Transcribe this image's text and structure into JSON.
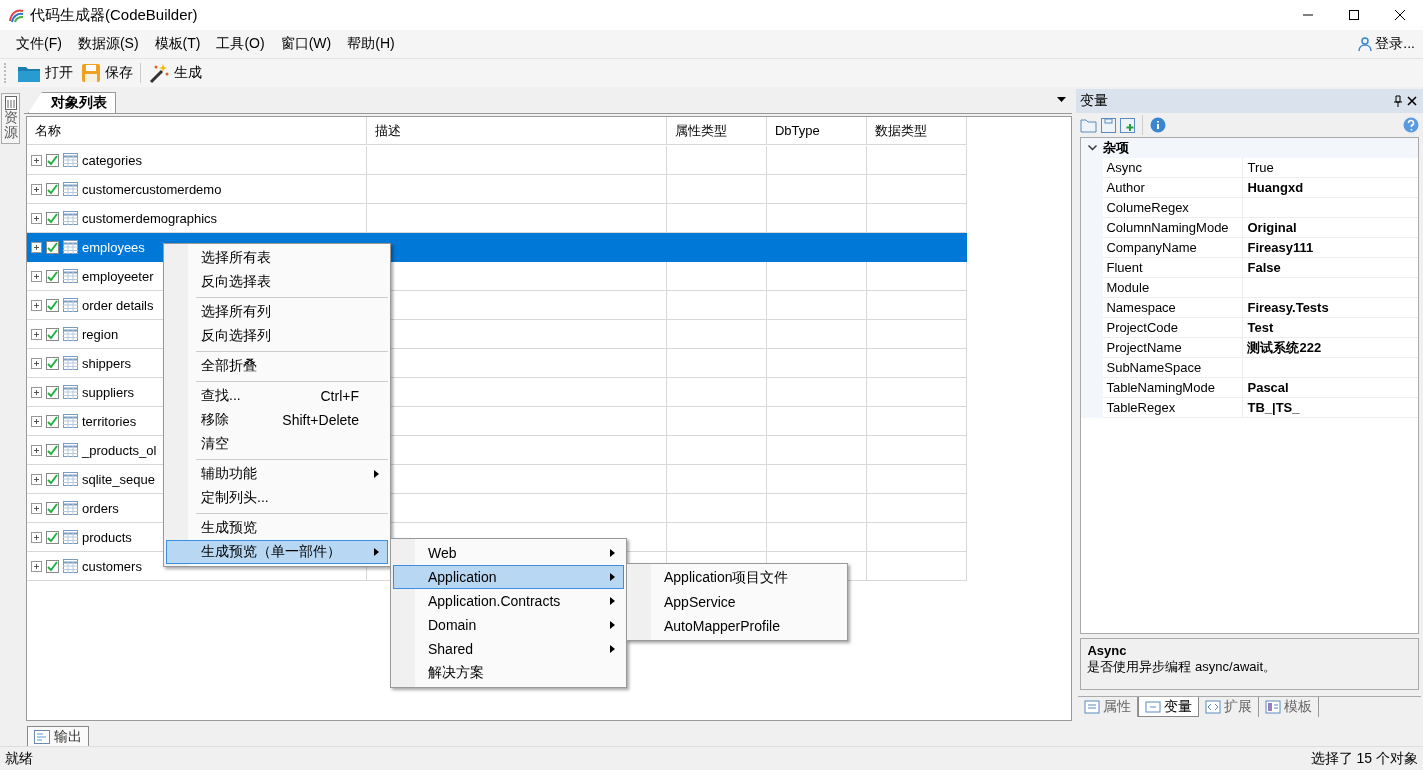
{
  "window": {
    "title": "代码生成器(CodeBuilder)"
  },
  "menu_bar": {
    "items": [
      "文件(F)",
      "数据源(S)",
      "模板(T)",
      "工具(O)",
      "窗口(W)",
      "帮助(H)"
    ],
    "login": "登录..."
  },
  "toolbar": [
    {
      "kind": "open",
      "label": "打开"
    },
    {
      "kind": "save",
      "label": "保存"
    },
    {
      "kind": "separator"
    },
    {
      "kind": "generate",
      "label": "生成"
    }
  ],
  "side_tabs": [
    {
      "label": "资源"
    }
  ],
  "document": {
    "tabs": [
      {
        "label": "对象列表",
        "selected": true
      }
    ],
    "table": {
      "columns": [
        "名称",
        "描述",
        "属性类型",
        "DbType",
        "数据类型"
      ],
      "rows": [
        {
          "name": "categories",
          "checked": true,
          "selected": false
        },
        {
          "name": "customercustomerdemo",
          "checked": true,
          "selected": false
        },
        {
          "name": "customerdemographics",
          "checked": true,
          "selected": false
        },
        {
          "name": "employees",
          "checked": true,
          "selected": true
        },
        {
          "name": "employeeter",
          "checked": true,
          "selected": false
        },
        {
          "name": "order details",
          "checked": true,
          "selected": false
        },
        {
          "name": "region",
          "checked": true,
          "selected": false
        },
        {
          "name": "shippers",
          "checked": true,
          "selected": false
        },
        {
          "name": "suppliers",
          "checked": true,
          "selected": false
        },
        {
          "name": "territories",
          "checked": true,
          "selected": false
        },
        {
          "name": "_products_ol",
          "checked": true,
          "selected": false
        },
        {
          "name": "sqlite_seque",
          "checked": true,
          "selected": false
        },
        {
          "name": "orders",
          "checked": true,
          "selected": false
        },
        {
          "name": "products",
          "checked": true,
          "selected": false
        },
        {
          "name": "customers",
          "checked": true,
          "selected": false
        }
      ]
    }
  },
  "context_menu": {
    "items": [
      {
        "kind": "item",
        "label": "选择所有表",
        "selected": false
      },
      {
        "kind": "item",
        "label": "反向选择表",
        "selected": false
      },
      {
        "kind": "separator"
      },
      {
        "kind": "item",
        "label": "选择所有列",
        "selected": false
      },
      {
        "kind": "item",
        "label": "反向选择列",
        "selected": false
      },
      {
        "kind": "separator"
      },
      {
        "kind": "item",
        "label": "全部折叠",
        "selected": false
      },
      {
        "kind": "separator"
      },
      {
        "kind": "item",
        "label": "查找...",
        "shortcut": "Ctrl+F",
        "selected": false
      },
      {
        "kind": "item",
        "label": "移除",
        "shortcut": "Shift+Delete",
        "selected": false
      },
      {
        "kind": "item",
        "label": "清空",
        "selected": false
      },
      {
        "kind": "separator"
      },
      {
        "kind": "item",
        "label": "辅助功能",
        "submenu": true,
        "selected": false
      },
      {
        "kind": "item",
        "label": "定制列头...",
        "selected": false
      },
      {
        "kind": "separator"
      },
      {
        "kind": "item",
        "label": "生成预览",
        "selected": false
      },
      {
        "kind": "item",
        "label": "生成预览（单一部件）",
        "submenu": true,
        "selected": true,
        "children": [
          {
            "kind": "item",
            "label": "Web",
            "submenu": true,
            "selected": false
          },
          {
            "kind": "item",
            "label": "Application",
            "submenu": true,
            "selected": true,
            "children": [
              {
                "kind": "item",
                "label": "Application项目文件",
                "selected": false
              },
              {
                "kind": "item",
                "label": "AppService",
                "selected": false
              },
              {
                "kind": "item",
                "label": "AutoMapperProfile",
                "selected": false
              }
            ]
          },
          {
            "kind": "item",
            "label": "Application.Contracts",
            "submenu": true,
            "selected": false
          },
          {
            "kind": "item",
            "label": "Domain",
            "submenu": true,
            "selected": false
          },
          {
            "kind": "item",
            "label": "Shared",
            "submenu": true,
            "selected": false
          },
          {
            "kind": "item",
            "label": "解决方案",
            "selected": false
          }
        ]
      }
    ]
  },
  "panel": {
    "title": "变量",
    "categories": [
      {
        "label": "杂项",
        "expanded": true,
        "items": [
          {
            "name": "Async",
            "value": "True",
            "modified": false
          },
          {
            "name": "Author",
            "value": "Huangxd",
            "modified": true
          },
          {
            "name": "ColumeRegex"
          },
          {
            "name": "ColumnNamingMode",
            "value": "Original",
            "modified": true
          },
          {
            "name": "CompanyName",
            "value": "Fireasy111",
            "modified": true
          },
          {
            "name": "Fluent",
            "value": "False",
            "modified": true
          },
          {
            "name": "Module"
          },
          {
            "name": "Namespace",
            "value": "Fireasy.Tests",
            "modified": true
          },
          {
            "name": "ProjectCode",
            "value": "Test",
            "modified": true
          },
          {
            "name": "ProjectName",
            "value": "测试系统222",
            "modified": true
          },
          {
            "name": "SubNameSpace"
          },
          {
            "name": "TableNamingMode",
            "value": "Pascal",
            "modified": true
          },
          {
            "name": "TableRegex",
            "value": "TB_|TS_",
            "modified": true
          }
        ]
      }
    ],
    "description": {
      "title": "Async",
      "text": "是否使用异步编程 async/await。"
    },
    "tabs": [
      {
        "kind": "properties",
        "label": "属性",
        "selected": false
      },
      {
        "kind": "variables",
        "label": "变量",
        "selected": true
      },
      {
        "kind": "extensions",
        "label": "扩展",
        "selected": false
      },
      {
        "kind": "templates",
        "label": "模板",
        "selected": false
      }
    ]
  },
  "bottom_tabs": [
    {
      "label": "输出",
      "selected": true
    }
  ],
  "status_bar": {
    "left": "就绪",
    "right": "选择了 15 个对象"
  }
}
